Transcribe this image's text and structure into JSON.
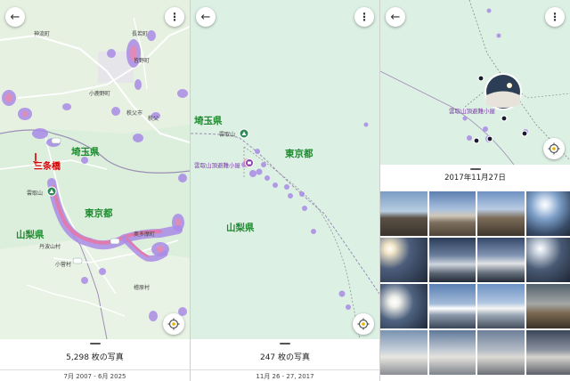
{
  "panels": [
    {
      "map": {
        "prefectures": [
          "埼玉県",
          "東京都",
          "山梨県"
        ],
        "places": [
          "神流町",
          "長若町",
          "皆野町",
          "小鹿野町",
          "秩父市",
          "秩父",
          "雲取山",
          "奥多摩町",
          "丹波山村",
          "小菅村",
          "檜原村"
        ],
        "landmark": "三条橋"
      },
      "sheet": {
        "count": "5,298 枚の写真",
        "range": "7月 2007 - 6月 2025"
      }
    },
    {
      "map": {
        "prefectures": [
          "埼玉県",
          "東京都",
          "山梨県"
        ],
        "places": [
          "雲取山"
        ],
        "hut": "雲取山頂避難小屋"
      },
      "sheet": {
        "count": "247 枚の写真",
        "range": "11月 26 - 27, 2017"
      }
    },
    {
      "map": {
        "hut": "雲取山頂避難小屋"
      },
      "sheet": {
        "date": "2017年11月27日"
      }
    }
  ],
  "icons": {
    "back": "arrow-back-icon",
    "more": "more-vert-icon",
    "locate": "my-location-icon"
  },
  "colors": {
    "map_bg": "#dcefdc",
    "green_text": "#1e8a2e",
    "heat_purple": "#a98be6",
    "heat_pink": "#e07bb0",
    "hut_text": "#7c3aa8",
    "landmark_red": "#d40000"
  }
}
